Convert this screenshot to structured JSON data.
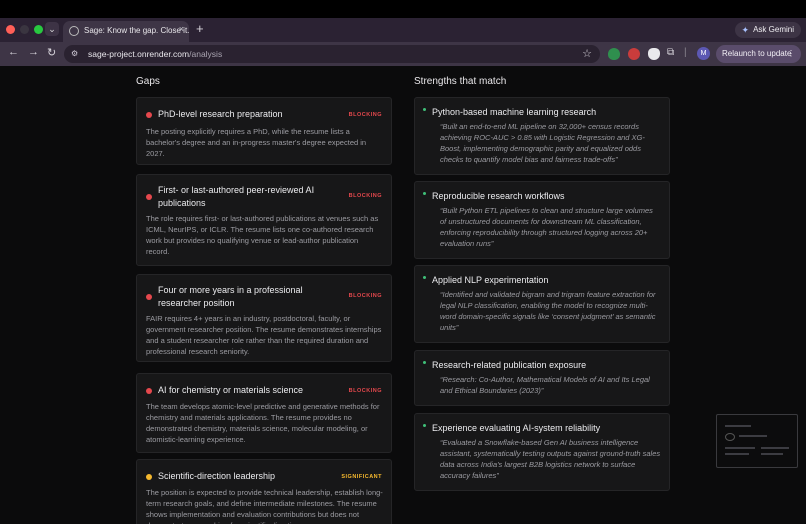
{
  "browser": {
    "window_controls": {
      "close_color": "#ff5f57",
      "minimize_color": "#3a3540",
      "maximize_color": "#28c840"
    },
    "tab": {
      "title": "Sage: Know the gap. Close it.",
      "close": "×"
    },
    "new_tab": "+",
    "ask_gemini": "Ask Gemini",
    "url_host": "sage-project.onrender.com",
    "url_path": "/analysis",
    "avatar_initial": "M",
    "relaunch_label": "Relaunch to update",
    "icons": [
      "back-icon",
      "forward-icon",
      "reload-icon",
      "site-info-icon",
      "bookmark-star-icon",
      "extension-icon",
      "more-icon"
    ]
  },
  "gaps": {
    "heading": "Gaps",
    "items": [
      {
        "title": "PhD-level research preparation",
        "severity": "BLOCKING",
        "dot_color": "#e5484d",
        "description": "The posting explicitly requires a PhD, while the resume lists a bachelor's degree and an in-progress master's degree expected in 2027."
      },
      {
        "title": "First- or last-authored peer-reviewed AI publications",
        "severity": "BLOCKING",
        "dot_color": "#e5484d",
        "description": "The role requires first- or last-authored publications at venues such as ICML, NeurIPS, or ICLR. The resume lists one co-authored research work but provides no qualifying venue or lead-author publication record."
      },
      {
        "title": "Four or more years in a professional researcher position",
        "severity": "BLOCKING",
        "dot_color": "#e5484d",
        "description": "FAIR requires 4+ years in an industry, postdoctoral, faculty, or government researcher position. The resume demonstrates internships and a student researcher role rather than the required duration and professional research seniority."
      },
      {
        "title": "AI for chemistry or materials science",
        "severity": "BLOCKING",
        "dot_color": "#e5484d",
        "description": "The team develops atomic-level predictive and generative methods for chemistry and materials applications. The resume provides no demonstrated chemistry, materials science, molecular modeling, or atomistic-learning experience."
      },
      {
        "title": "Scientific-direction leadership",
        "severity": "SIGNIFICANT",
        "dot_color": "#f5b82e",
        "description": "The position is expected to provide technical leadership, establish long-term research goals, and define intermediate milestones. The resume shows implementation and evaluation contributions but does not demonstrate ownership of a scientific direction."
      }
    ]
  },
  "strengths": {
    "heading": "Strengths that match",
    "items": [
      {
        "title": "Python-based machine learning research",
        "quote": "“Built an end-to-end ML pipeline on 32,000+ census records achieving ROC-AUC > 0.85 with Logistic Regression and XG-Boost, implementing demographic parity and equalized odds checks to quantify model bias and fairness trade-offs”"
      },
      {
        "title": "Reproducible research workflows",
        "quote": "“Built Python ETL pipelines to clean and structure large volumes of unstructured documents for downstream ML classification, enforcing reproducibility through structured logging across 20+ evaluation runs”"
      },
      {
        "title": "Applied NLP experimentation",
        "quote": "“Identified and validated bigram and trigram feature extraction for legal NLP classification, enabling the model to recognize multi-word domain-specific signals like ‘consent judgment’ as semantic units”"
      },
      {
        "title": "Research-related publication exposure",
        "quote": "“Research: Co-Author, Mathematical Models of AI and Its Legal and Ethical Boundaries (2023)”"
      },
      {
        "title": "Experience evaluating AI-system reliability",
        "quote": "“Evaluated a Snowflake-based Gen AI business intelligence assistant, systematically testing outputs against ground-truth sales data across India's largest B2B logistics network to surface accuracy failures”"
      }
    ]
  },
  "colors": {
    "blocking": "#e5484d",
    "significant": "#f5b82e",
    "strength_dot": "#3fbf78"
  }
}
